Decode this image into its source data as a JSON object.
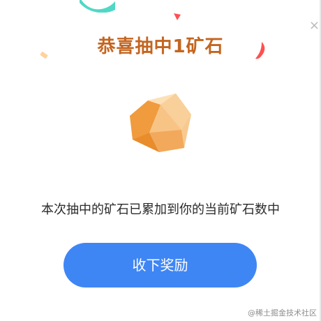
{
  "dialog": {
    "title": "恭喜抽中1矿石",
    "close_icon_glyph": "×",
    "message": "本次抽中的矿石已累加到你的当前矿石数中",
    "collect_button_label": "收下奖励"
  },
  "watermark": {
    "text": "@稀土掘金技术社区"
  },
  "colors": {
    "title": "#c4651f",
    "button": "#3f86f5",
    "stone_light": "#f8c98f",
    "stone_dark": "#e98c2b",
    "confetti_teal": "#4fd8c5",
    "confetti_red": "#ff5050",
    "confetti_peach": "#ffd29a"
  }
}
